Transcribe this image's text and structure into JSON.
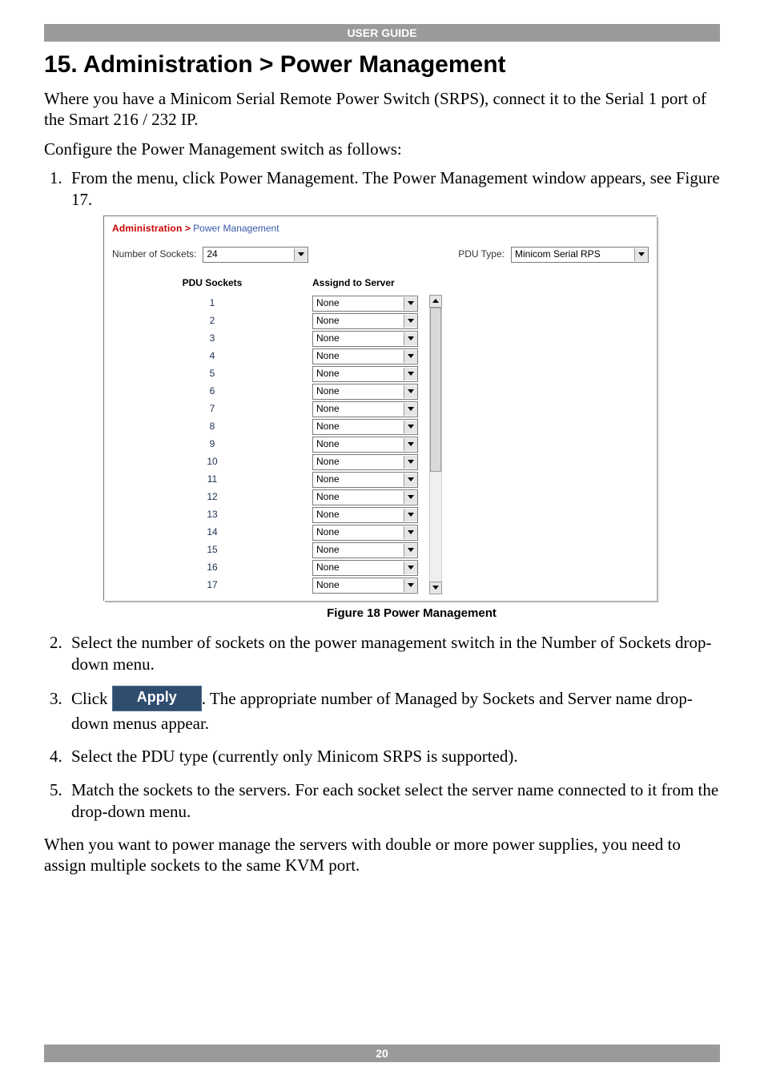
{
  "header": {
    "title": "USER GUIDE"
  },
  "heading": "15. Administration > Power Management",
  "intro1": "Where you have a Minicom Serial Remote Power Switch (SRPS), connect it to the Serial 1 port of the Smart 216 / 232 IP.",
  "intro2": "Configure the Power Management switch as follows:",
  "step1": "From the menu, click Power Management. The Power Management window appears, see Figure 17.",
  "figureCaption": "Figure 18 Power Management",
  "step2": "Select the number of sockets on the power management switch in the Number of Sockets drop-down menu.",
  "step3_pre": "Click ",
  "apply_label": "Apply",
  "step3_post": ". The appropriate number of Managed by Sockets and Server name drop-down menus appear.",
  "step4": "Select the PDU type (currently only Minicom SRPS is supported).",
  "step5": "Match the sockets to the servers. For each socket select the server name connected to it from the drop-down menu.",
  "closing": "When you want to power manage the servers with double or more power supplies, you need to assign multiple sockets to the same KVM port.",
  "footer": {
    "page": "20"
  },
  "screenshot": {
    "breadcrumb": {
      "admin": "Administration",
      "sep": ">",
      "pm": "Power Management"
    },
    "labels": {
      "numSockets": "Number of Sockets:",
      "pduType": "PDU Type:",
      "colSockets": "PDU Sockets",
      "colAssigned": "Assignd to Server"
    },
    "values": {
      "numSockets": "24",
      "pduType": "Minicom Serial RPS"
    },
    "rows": [
      {
        "n": "1",
        "v": "None"
      },
      {
        "n": "2",
        "v": "None"
      },
      {
        "n": "3",
        "v": "None"
      },
      {
        "n": "4",
        "v": "None"
      },
      {
        "n": "5",
        "v": "None"
      },
      {
        "n": "6",
        "v": "None"
      },
      {
        "n": "7",
        "v": "None"
      },
      {
        "n": "8",
        "v": "None"
      },
      {
        "n": "9",
        "v": "None"
      },
      {
        "n": "10",
        "v": "None"
      },
      {
        "n": "11",
        "v": "None"
      },
      {
        "n": "12",
        "v": "None"
      },
      {
        "n": "13",
        "v": "None"
      },
      {
        "n": "14",
        "v": "None"
      },
      {
        "n": "15",
        "v": "None"
      },
      {
        "n": "16",
        "v": "None"
      },
      {
        "n": "17",
        "v": "None"
      }
    ]
  }
}
